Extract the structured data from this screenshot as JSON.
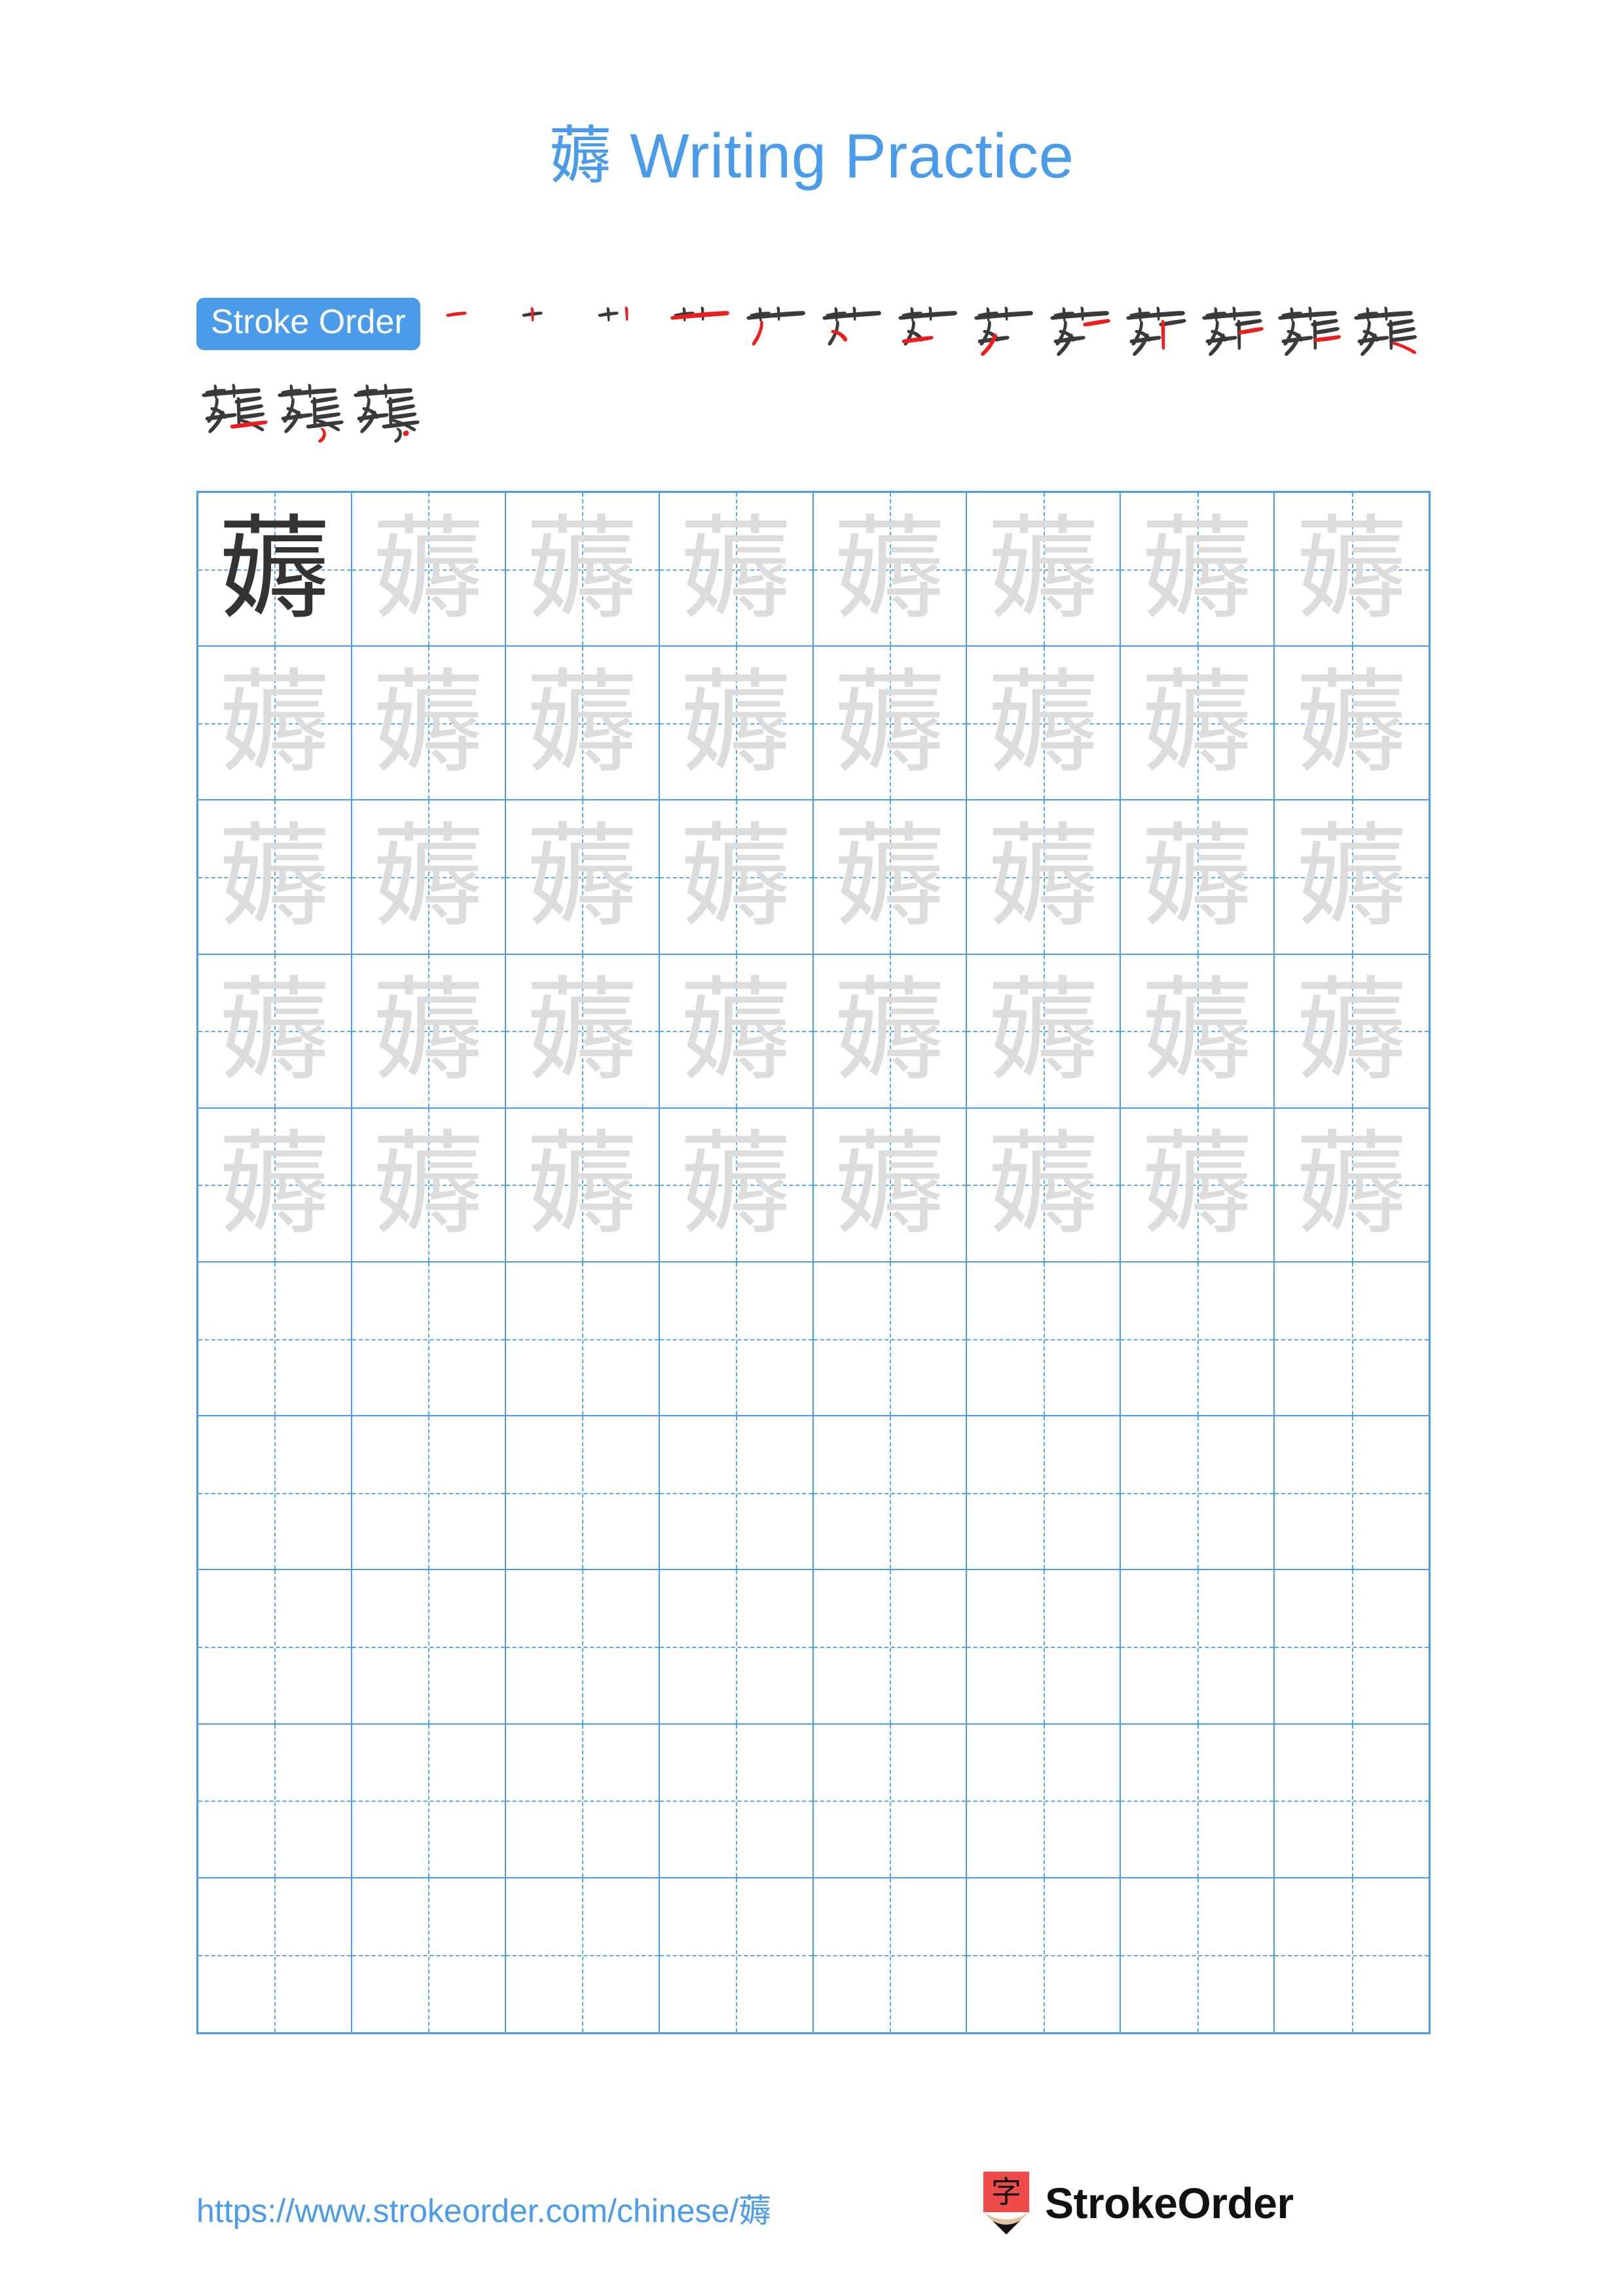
{
  "page": {
    "character": "薅",
    "title_suffix": " Writing Practice",
    "background_color": "#ffffff",
    "accent_color": "#4a9ceb"
  },
  "header": {
    "title_char": "薅",
    "title_text": "Writing Practice"
  },
  "stroke_order": {
    "badge_label": "Stroke Order",
    "total_strokes": 16,
    "done_color": "#3a3a3a",
    "new_color": "#ee1c1c",
    "steps": [
      {
        "index": 1,
        "partial": "一"
      },
      {
        "index": 2,
        "partial": "十"
      },
      {
        "index": 3,
        "partial": "艹"
      },
      {
        "index": 4,
        "partial": "𰀪"
      },
      {
        "index": 5,
        "partial": "艿"
      },
      {
        "index": 6,
        "partial": "芀"
      },
      {
        "index": 7,
        "partial": "芐"
      },
      {
        "index": 8,
        "partial": "芦"
      },
      {
        "index": 9,
        "partial": "荦"
      },
      {
        "index": 10,
        "partial": "茊"
      },
      {
        "index": 11,
        "partial": "茋"
      },
      {
        "index": 12,
        "partial": "蒁"
      },
      {
        "index": 13,
        "partial": "蒃"
      },
      {
        "index": 14,
        "partial": "蒅"
      },
      {
        "index": 15,
        "partial": "蒆"
      },
      {
        "index": 16,
        "partial": "薅"
      }
    ]
  },
  "practice_grid": {
    "columns": 8,
    "rows": 10,
    "grid_line_color": "#4a9ceb",
    "guide_line_color": "#5aa8ee",
    "model_glyph_color": "#333333",
    "trace_glyph_color": "#dcdcdc",
    "glyph": "薅",
    "filled_rows": 5,
    "empty_rows": 5,
    "model_cell_index": 0
  },
  "footer": {
    "url": "https://www.strokeorder.com/chinese/薅",
    "brand_name": "StrokeOrder",
    "brand_icon_char": "字",
    "brand_icon_body_color": "#ef4b4b",
    "brand_icon_wood_color": "#e0c39e",
    "brand_icon_tip_color": "#111111"
  }
}
